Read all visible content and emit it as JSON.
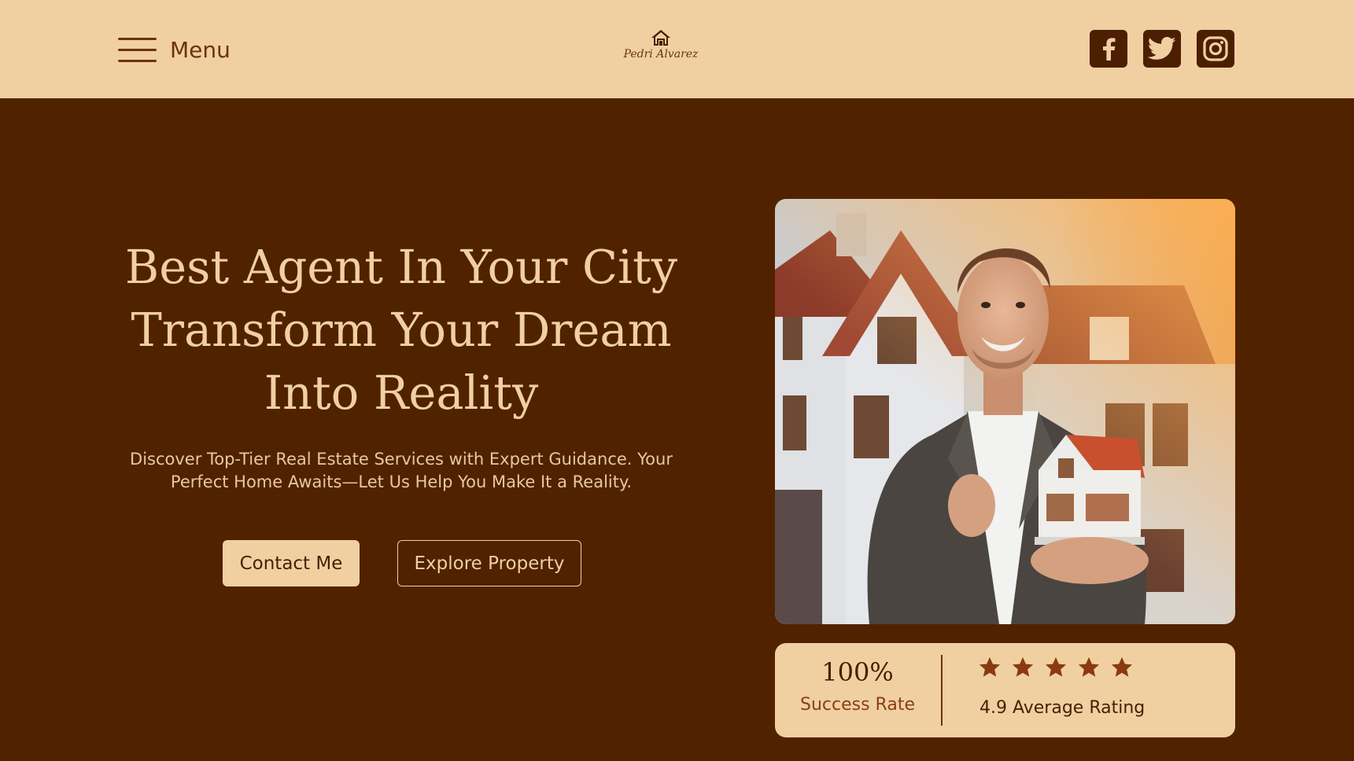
{
  "header": {
    "menu_label": "Menu",
    "logo_text": "Pedri Alvarez",
    "socials": [
      {
        "icon": "facebook-icon"
      },
      {
        "icon": "twitter-icon"
      },
      {
        "icon": "instagram-icon"
      }
    ]
  },
  "hero": {
    "title_line1": "Best Agent In Your City",
    "title_line2": "Transform Your Dream",
    "title_line3": "Into Reality",
    "subtitle": "Discover Top-Tier Real Estate Services with Expert Guidance. Your Perfect Home Awaits—Let Us Help You Make It a Reality.",
    "contact_button": "Contact Me",
    "explore_button": "Explore Property"
  },
  "stats": {
    "success_value": "100%",
    "success_label": "Success Rate",
    "stars": 5,
    "rating_label": "4.9 Average Rating"
  },
  "colors": {
    "background": "#512200",
    "accent": "#f0d0a1",
    "dark": "#4d1f02"
  }
}
